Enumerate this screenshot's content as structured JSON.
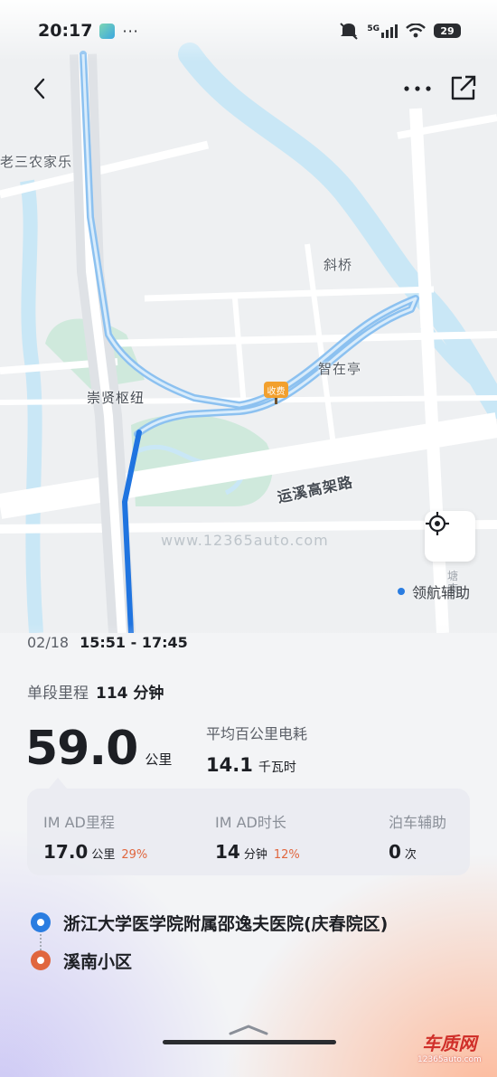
{
  "status_bar": {
    "time": "20:17",
    "dots": "···",
    "network": "5G",
    "battery": "29"
  },
  "top_bar": {
    "back_icon": "chevron-left-icon",
    "more_icon": "more-dots-icon",
    "share_icon": "share-icon"
  },
  "map": {
    "labels": {
      "farmhouse": "老三农家乐",
      "xieqiao": "斜桥",
      "zhizaiting": "智在亭",
      "hub": "崇贤枢纽",
      "expressway": "运溪高架路",
      "side_vertical": "塘康",
      "toll": "收费"
    },
    "watermark": "www.12365auto.com",
    "nav_assist_label": "领航辅助",
    "colors": {
      "route_light": "#8cc1f0",
      "route_dark": "#1f74e0",
      "water": "#c9e7f6",
      "green": "#cfe9dc"
    }
  },
  "trip": {
    "date": "02/18",
    "time_range": "15:51 - 17:45",
    "segment_label": "单段里程",
    "segment_value": "114 分钟",
    "distance_value": "59.0",
    "distance_unit": "公里",
    "consumption_label": "平均百公里电耗",
    "consumption_value": "14.1",
    "consumption_unit": "千瓦时"
  },
  "stats": {
    "imad_distance": {
      "label": "IM AD里程",
      "value": "17.0",
      "unit": "公里",
      "percent": "29%"
    },
    "imad_duration": {
      "label": "IM AD时长",
      "value": "14",
      "unit": "分钟",
      "percent": "12%"
    },
    "parking_assist": {
      "label": "泊车辅助",
      "value": "0",
      "unit": "次"
    }
  },
  "route": {
    "start": "浙江大学医学院附属邵逸夫医院(庆春院区)",
    "end": "溪南小区"
  },
  "brand": {
    "logo": "车质网",
    "url": "12365auto.com"
  }
}
